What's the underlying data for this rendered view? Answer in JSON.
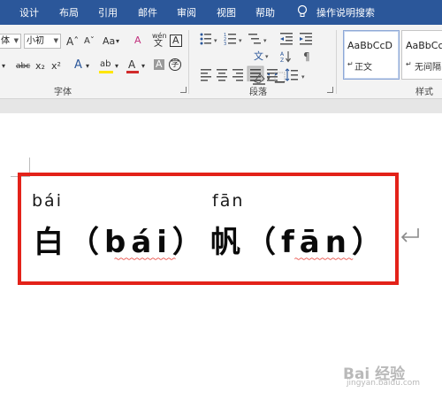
{
  "tabs": [
    "设计",
    "布局",
    "引用",
    "邮件",
    "审阅",
    "视图",
    "帮助"
  ],
  "tell_me": "操作说明搜索",
  "font": {
    "name_value": "体",
    "size_value": "小初",
    "grow_label": "Aˆ",
    "shrink_label": "Aˇ",
    "change_case": "Aa",
    "clear_format": "A",
    "phonetic_guide": "wén",
    "char_border": "A",
    "strikethrough": "abc",
    "subscript": "x₂",
    "superscript": "x²",
    "text_effects": "A",
    "highlight": "ab",
    "font_color": "A",
    "char_shading": "A",
    "enclose": "字",
    "group_label": "字体"
  },
  "paragraph": {
    "group_label": "段落"
  },
  "styles": {
    "items": [
      {
        "sample": "AaBbCcD",
        "name": "正文"
      },
      {
        "sample": "AaBbCcI",
        "name": "无间隔"
      }
    ],
    "group_label": "样式"
  },
  "colors": {
    "ribbon_tabs": "#2b579a",
    "frame": "#e32219",
    "highlight": "#ffe600",
    "font_color": "#d12b2b"
  },
  "document": {
    "pinyin_bai": "bái",
    "pinyin_fan": "fān",
    "char_bai": "白",
    "annotation_bai": "（bái）",
    "char_fan": "帆",
    "annotation_fan": "（fān）"
  },
  "watermark": {
    "brand": "Bai 经验",
    "url": "jingyan.baidu.com"
  }
}
